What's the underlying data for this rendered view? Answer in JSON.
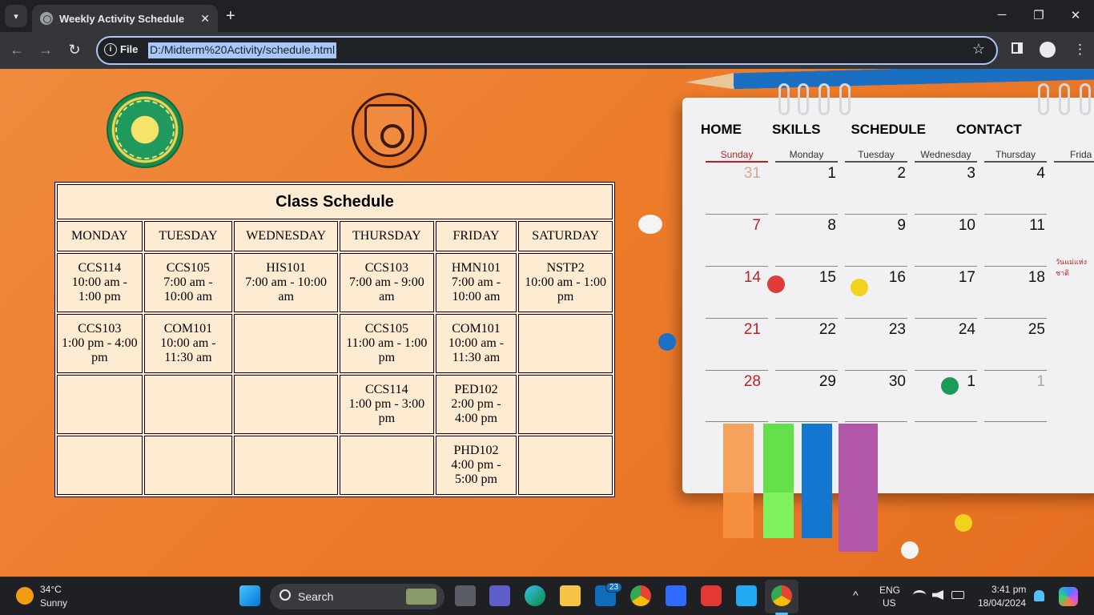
{
  "browser": {
    "tab_title": "Weekly Activity Schedule",
    "tab_close": "✕",
    "new_tab": "+",
    "file_label": "File",
    "url": "D:/Midterm%20Activity/schedule.html",
    "info_glyph": "i",
    "back_glyph": "←",
    "forward_glyph": "→",
    "reload_glyph": "↻",
    "star_glyph": "☆",
    "minimize_glyph": "─",
    "restore_glyph": "❐",
    "close_glyph": "✕",
    "menu_glyph": "⋮",
    "tab_dropdown_glyph": "▾"
  },
  "schedule": {
    "title": "Class Schedule",
    "days": [
      "MONDAY",
      "TUESDAY",
      "WEDNESDAY",
      "THURSDAY",
      "FRIDAY",
      "SATURDAY"
    ],
    "rows": [
      [
        {
          "code": "CCS114",
          "time": "10:00 am - 1:00 pm"
        },
        {
          "code": "CCS105",
          "time": "7:00 am - 10:00 am"
        },
        {
          "code": "HIS101",
          "time": "7:00 am - 10:00 am"
        },
        {
          "code": "CCS103",
          "time": "7:00 am - 9:00 am"
        },
        {
          "code": "HMN101",
          "time": "7:00 am - 10:00 am"
        },
        {
          "code": "NSTP2",
          "time": "10:00 am - 1:00 pm"
        }
      ],
      [
        {
          "code": "CCS103",
          "time": "1:00 pm - 4:00 pm"
        },
        {
          "code": "COM101",
          "time": "10:00 am - 11:30 am"
        },
        {
          "code": "",
          "time": ""
        },
        {
          "code": "CCS105",
          "time": "11:00 am - 1:00 pm"
        },
        {
          "code": "COM101",
          "time": "10:00 am - 11:30 am"
        },
        {
          "code": "",
          "time": ""
        }
      ],
      [
        {
          "code": "",
          "time": ""
        },
        {
          "code": "",
          "time": ""
        },
        {
          "code": "",
          "time": ""
        },
        {
          "code": "CCS114",
          "time": "1:00 pm - 3:00 pm"
        },
        {
          "code": "PED102",
          "time": "2:00 pm - 4:00 pm"
        },
        {
          "code": "",
          "time": ""
        }
      ],
      [
        {
          "code": "",
          "time": ""
        },
        {
          "code": "",
          "time": ""
        },
        {
          "code": "",
          "time": ""
        },
        {
          "code": "",
          "time": ""
        },
        {
          "code": "PHD102",
          "time": "4:00 pm - 5:00 pm"
        },
        {
          "code": "",
          "time": ""
        }
      ]
    ]
  },
  "nav": {
    "home": "HOME",
    "skills": "SKILLS",
    "schedule": "SCHEDULE",
    "contact": "CONTACT"
  },
  "calendar_image": {
    "day_headers": [
      "Sunday",
      "Monday",
      "Tuesday",
      "Wednesday",
      "Thursday",
      "Frida"
    ],
    "weeks": [
      [
        "31",
        "1",
        "2",
        "3",
        "4"
      ],
      [
        "7",
        "8",
        "9",
        "10",
        "11"
      ],
      [
        "14",
        "15",
        "16",
        "17",
        "18"
      ],
      [
        "21",
        "22",
        "23",
        "24",
        "25"
      ],
      [
        "28",
        "29",
        "30",
        "1",
        "1"
      ]
    ],
    "holiday_text": "วันแม่แห่งชาติ"
  },
  "taskbar": {
    "weather_temp": "34°C",
    "weather_desc": "Sunny",
    "search_label": "Search",
    "mail_badge": "23",
    "lang_top": "ENG",
    "lang_bottom": "US",
    "time": "3:41 pm",
    "date": "18/04/2024",
    "tray_chevron": "^"
  },
  "colors": {
    "page_bg": "#ec7c2b",
    "table_bg": "#fdecd2",
    "url_highlight": "#a8c7fa"
  }
}
